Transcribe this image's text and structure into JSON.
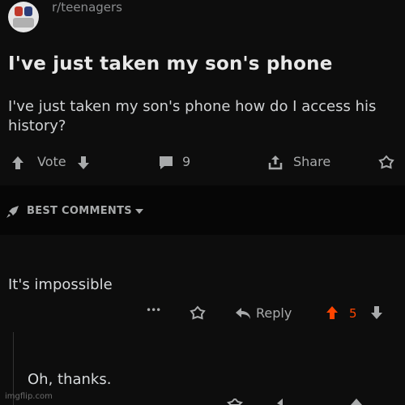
{
  "post": {
    "subreddit": "r/teenagers",
    "title": "I've just taken my son's phone",
    "body": "I've just taken my son's phone how do I access his history?"
  },
  "actions": {
    "vote_label": "Vote",
    "comment_count": "9",
    "share_label": "Share"
  },
  "comments_header": {
    "label": "BEST COMMENTS"
  },
  "comments": [
    {
      "text": "It's impossible",
      "more_label": "•••",
      "reply_label": "Reply",
      "score": "5"
    },
    {
      "text": "Oh, thanks."
    }
  ],
  "watermark": "imgflip.com",
  "colors": {
    "background": "#0d0d0d",
    "upvote_active": "#ff4500",
    "muted": "#a8aaab"
  }
}
